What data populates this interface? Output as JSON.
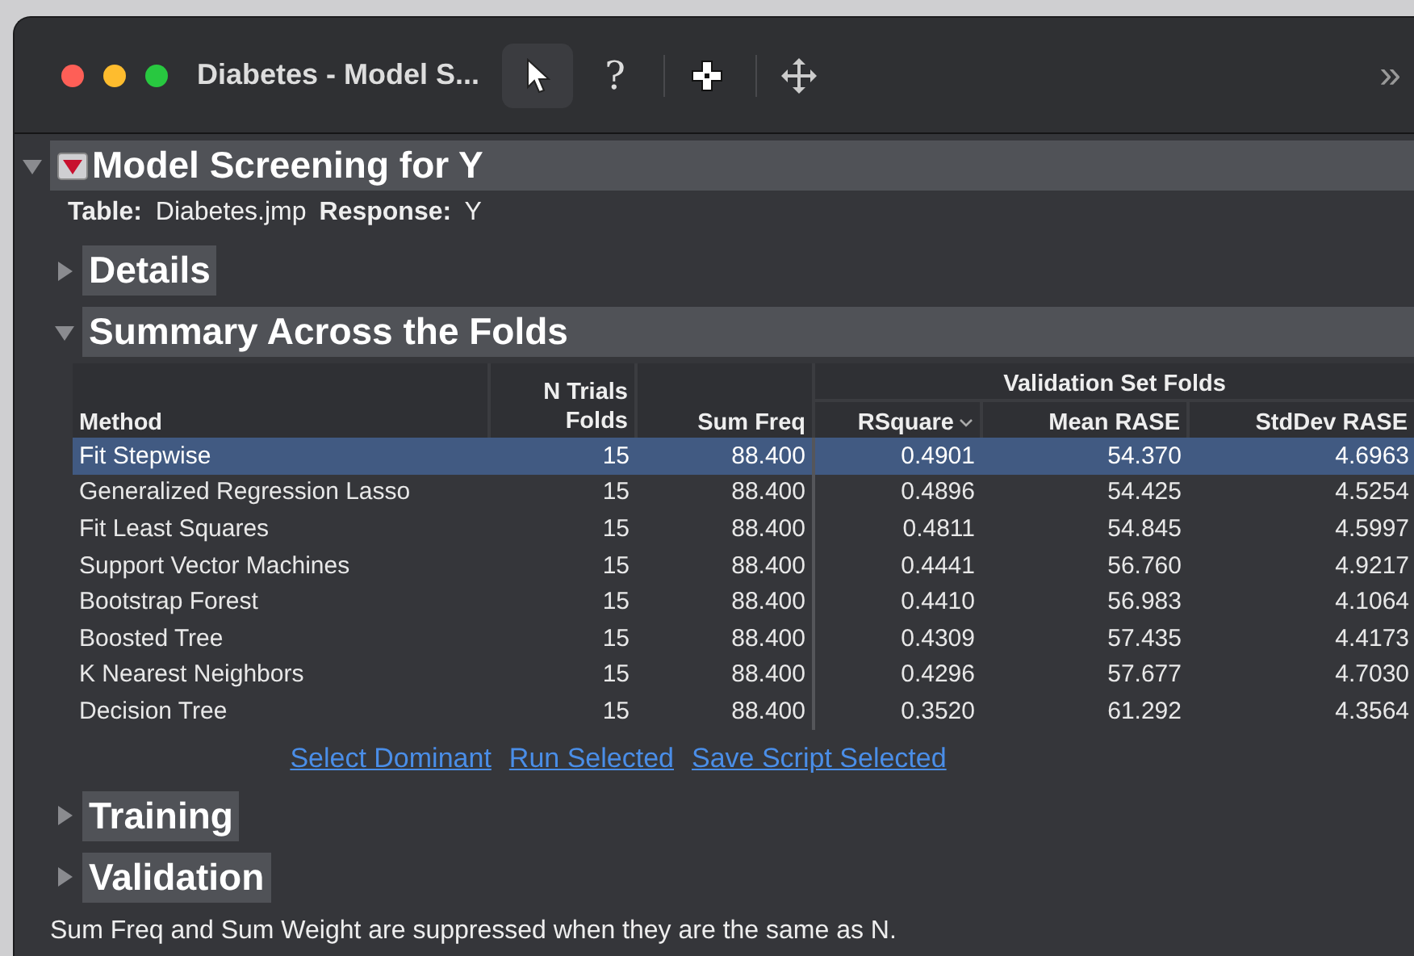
{
  "window": {
    "title": "Diabetes - Model S..."
  },
  "toolbar": {
    "tools": [
      {
        "kind": "arrow",
        "selected": true
      },
      {
        "kind": "help",
        "glyph": "?",
        "selected": false
      },
      {
        "kind": "crosshair",
        "selected": false
      },
      {
        "kind": "move",
        "selected": false
      }
    ],
    "overflow": "»"
  },
  "report": {
    "title": "Model Screening for Y",
    "expanded": true,
    "info": [
      {
        "label": "Table:",
        "value": "Diabetes.jmp"
      },
      {
        "label": "Response:",
        "value": "Y"
      }
    ],
    "sections": [
      {
        "title": "Details",
        "expanded": false
      },
      {
        "title": "Summary Across the Folds",
        "expanded": true,
        "table": {
          "group_header": "Validation Set Folds",
          "columns": [
            {
              "label": "Method",
              "sorted": false
            },
            {
              "label": "N Trials",
              "sub": "Folds",
              "sorted": false
            },
            {
              "label": "Sum Freq",
              "sorted": false
            },
            {
              "label": "RSquare",
              "sorted": true
            },
            {
              "label": "Mean RASE",
              "sorted": false
            },
            {
              "label": "StdDev RASE",
              "sorted": false
            }
          ],
          "rows": [
            {
              "selected": true,
              "cells": [
                "Fit Stepwise",
                "15",
                "88.400",
                "0.4901",
                "54.370",
                "4.6963"
              ]
            },
            {
              "selected": false,
              "cells": [
                "Generalized Regression Lasso",
                "15",
                "88.400",
                "0.4896",
                "54.425",
                "4.5254"
              ]
            },
            {
              "selected": false,
              "cells": [
                "Fit Least Squares",
                "15",
                "88.400",
                "0.4811",
                "54.845",
                "4.5997"
              ]
            },
            {
              "selected": false,
              "cells": [
                "Support Vector Machines",
                "15",
                "88.400",
                "0.4441",
                "56.760",
                "4.9217"
              ]
            },
            {
              "selected": false,
              "cells": [
                "Bootstrap Forest",
                "15",
                "88.400",
                "0.4410",
                "56.983",
                "4.1064"
              ]
            },
            {
              "selected": false,
              "cells": [
                "Boosted Tree",
                "15",
                "88.400",
                "0.4309",
                "57.435",
                "4.4173"
              ]
            },
            {
              "selected": false,
              "cells": [
                "K Nearest Neighbors",
                "15",
                "88.400",
                "0.4296",
                "57.677",
                "4.7030"
              ]
            },
            {
              "selected": false,
              "cells": [
                "Decision Tree",
                "15",
                "88.400",
                "0.3520",
                "61.292",
                "4.3564"
              ]
            }
          ],
          "links": [
            "Select Dominant",
            "Run Selected",
            "Save Script Selected"
          ]
        }
      },
      {
        "title": "Training",
        "expanded": false
      },
      {
        "title": "Validation",
        "expanded": false
      }
    ],
    "footnote": "Sum Freq and Sum Weight are suppressed when they are the same as N."
  }
}
